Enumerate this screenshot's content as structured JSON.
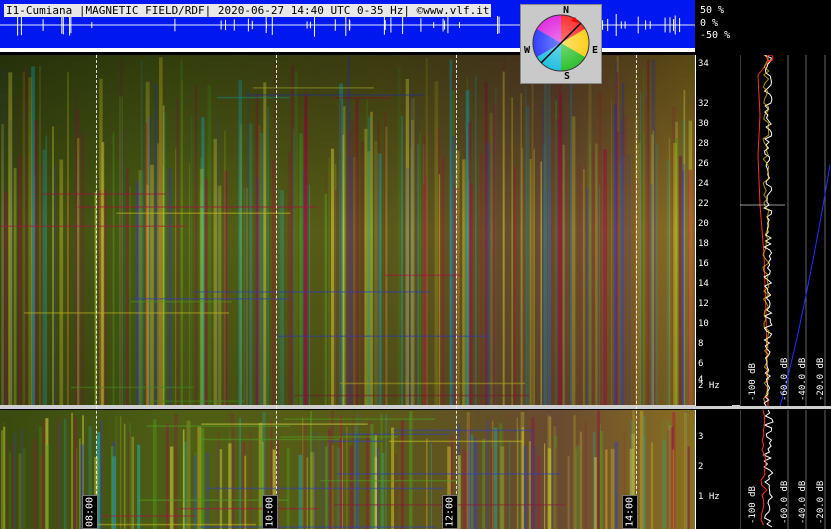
{
  "header": {
    "title": "I1-Cumiana |MAGNETIC FIELD/RDF| 2020-06-27 14:40 UTC 0-35 Hz| ©www.vlf.it",
    "amplitude_scale": [
      "50 %",
      "0 %",
      "-50 %"
    ]
  },
  "compass": {
    "north": "N",
    "south": "S",
    "east": "E",
    "west": "W"
  },
  "time_axis": {
    "labels": [
      "08:00",
      "10:00",
      "12:00",
      "14:00"
    ]
  },
  "frequency_axis_top": {
    "ticks": [
      "34",
      "32",
      "30",
      "28",
      "26",
      "24",
      "22",
      "20",
      "18",
      "16",
      "14",
      "12",
      "10",
      "8",
      "6",
      "4",
      "2 Hz"
    ]
  },
  "frequency_axis_bottom": {
    "ticks": [
      "3",
      "2",
      "1 Hz"
    ]
  },
  "spectrum_panel": {
    "db_labels_top": [
      "-100 dB",
      "-60.0 dB",
      "-40.0 dB",
      "-20.0 dB"
    ],
    "db_labels_bottom": [
      "-100 dB",
      "-60.0 dB",
      "-40.0 dB",
      "-20.0 dB"
    ]
  },
  "colors": {
    "header_blue": "#0018f0",
    "spec_green": "#4a6a12",
    "spec_yellow": "#c8c020",
    "spec_red": "#b01040",
    "spec_blue": "#3040c0",
    "trace_red": "#ff3020",
    "trace_white": "#ffffff",
    "trace_blue": "#2030ff"
  }
}
